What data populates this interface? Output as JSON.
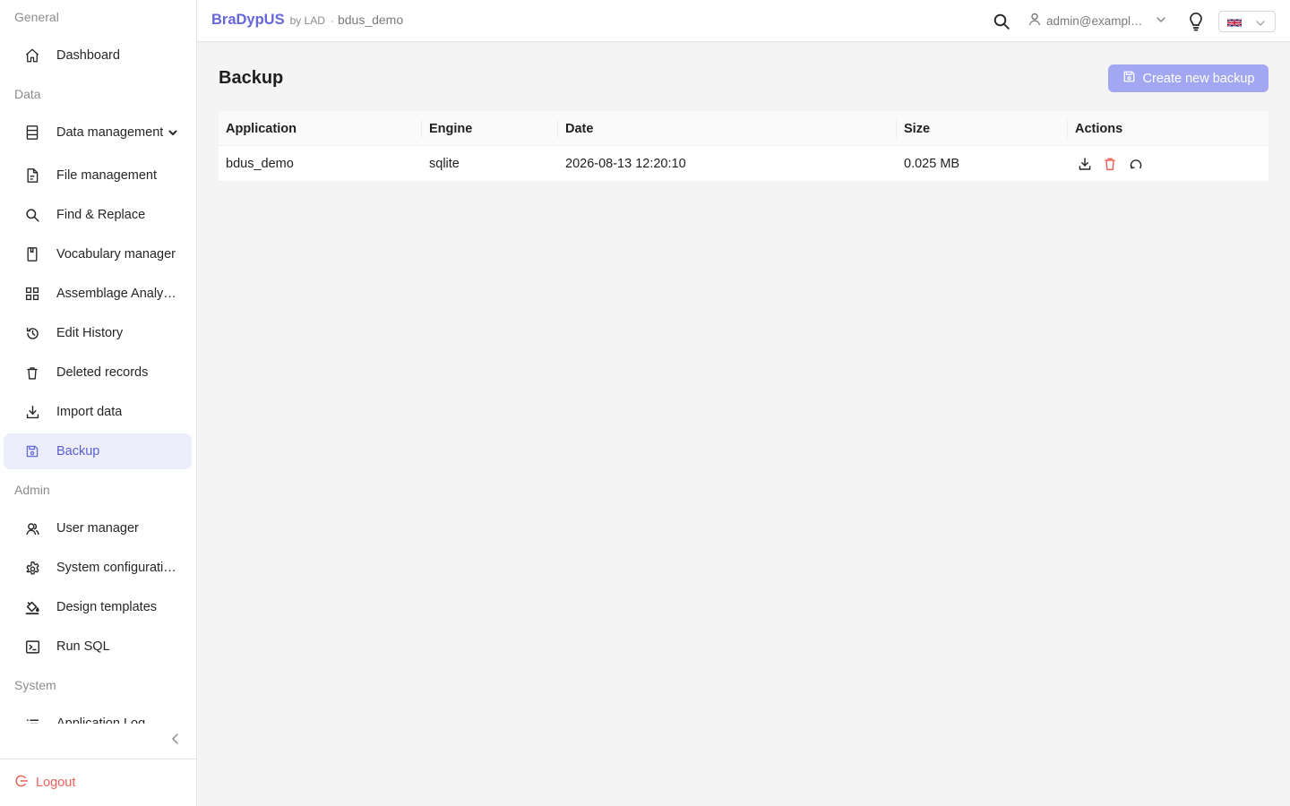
{
  "header": {
    "brand_name": "BraDypUS",
    "brand_by": "by LAD",
    "separator": "·",
    "app_name": "bdus_demo",
    "user": "admin@example.com",
    "language": "en-GB"
  },
  "sidebar": {
    "groups": [
      {
        "label": "General"
      },
      {
        "label": "Data"
      },
      {
        "label": "Admin"
      },
      {
        "label": "System"
      }
    ],
    "items": [
      {
        "label": "Dashboard"
      },
      {
        "label": "Data management"
      },
      {
        "label": "File management"
      },
      {
        "label": "Find & Replace"
      },
      {
        "label": "Vocabulary manager"
      },
      {
        "label": "Assemblage Analysis"
      },
      {
        "label": "Edit History"
      },
      {
        "label": "Deleted records"
      },
      {
        "label": "Import data"
      },
      {
        "label": "Backup"
      },
      {
        "label": "User manager"
      },
      {
        "label": "System configuration"
      },
      {
        "label": "Design templates"
      },
      {
        "label": "Run SQL"
      },
      {
        "label": "Application Log"
      }
    ],
    "active_item": "Backup",
    "logout_label": "Logout"
  },
  "main": {
    "title": "Backup",
    "create_button_label": "Create new backup",
    "table": {
      "columns": [
        "Application",
        "Engine",
        "Date",
        "Size",
        "Actions"
      ],
      "rows": [
        {
          "application": "bdus_demo",
          "engine": "sqlite",
          "date": "2026-08-13 12:20:10",
          "size": "0.025 MB",
          "actions": [
            "download-icon",
            "delete-icon",
            "restore-icon"
          ]
        }
      ]
    }
  },
  "colors": {
    "brand": "#6567d8",
    "active_bg": "#eceefb",
    "primary_button": "#a3a6f0",
    "danger": "#f0605a"
  }
}
